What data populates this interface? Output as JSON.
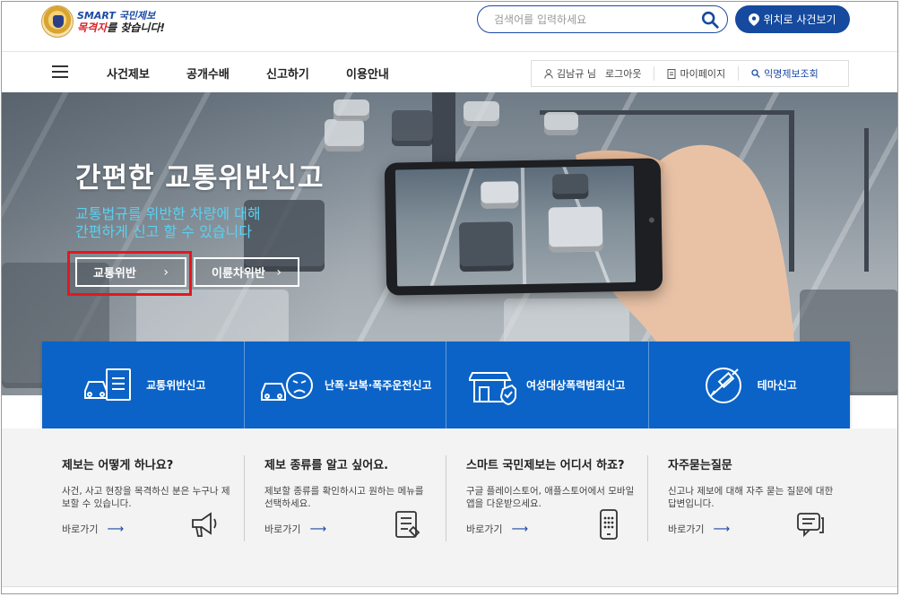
{
  "header": {
    "logo_sub": "SMART 국민제보",
    "logo_main_highlight": "목격자",
    "logo_main_rest": "를 찾습니다!",
    "search_placeholder": "검색어를 입력하세요",
    "location_button": "위치로 사건보기"
  },
  "nav": {
    "items": [
      "사건제보",
      "공개수배",
      "신고하기",
      "이용안내"
    ],
    "user": "김남규 님",
    "logout": "로그아웃",
    "mypage": "마이페이지",
    "anonymous": "익명제보조회"
  },
  "hero": {
    "title": "간편한 교통위반신고",
    "subtitle_line1": "교통법규를 위반한 차량에 대해",
    "subtitle_line2": "간편하게 신고 할 수 있습니다",
    "buttons": [
      "교통위반",
      "이륜차위반"
    ]
  },
  "categories": [
    {
      "label": "교통위반신고",
      "icon": "traffic-report-icon"
    },
    {
      "label": "난폭·보복·폭주운전신고",
      "icon": "angry-car-icon"
    },
    {
      "label": "여성대상폭력범죄신고",
      "icon": "shop-shield-icon"
    },
    {
      "label": "테마신고",
      "icon": "syringe-icon"
    }
  ],
  "info": [
    {
      "title": "제보는 어떻게 하나요?",
      "desc": "사건, 사고 현장을 목격하신 분은 누구나 제보할 수 있습니다.",
      "go": "바로가기",
      "icon": "megaphone-icon"
    },
    {
      "title": "제보 종류를 알고 싶어요.",
      "desc": "제보할 종류를 확인하시고 원하는 메뉴를 선택하세요.",
      "go": "바로가기",
      "icon": "checklist-icon"
    },
    {
      "title": "스마트 국민제보는 어디서 하죠?",
      "desc": "구글 플레이스토어, 애플스토어에서 모바일앱을 다운받으세요.",
      "go": "바로가기",
      "icon": "smartphone-icon"
    },
    {
      "title": "자주묻는질문",
      "desc": "신고나 제보에 대해 자주 묻는 질문에 대한 답변입니다.",
      "go": "바로가기",
      "icon": "chat-icon"
    }
  ],
  "colors": {
    "primary_blue": "#0b63c7",
    "dark_blue": "#154a9e",
    "highlight_red": "#e5171e",
    "subtitle_cyan": "#5ad1f2"
  }
}
